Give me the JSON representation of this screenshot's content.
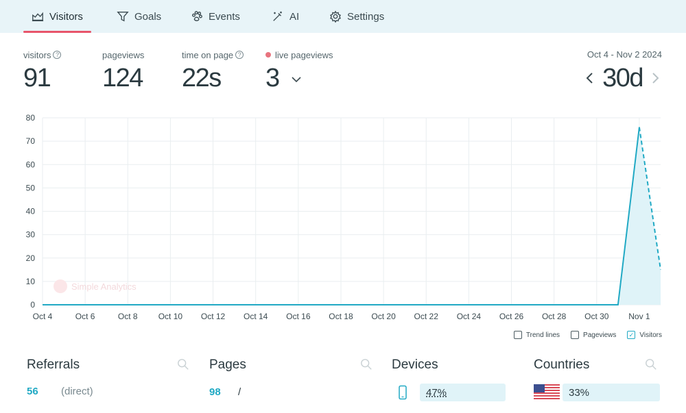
{
  "tabs": [
    {
      "label": "Visitors",
      "icon": "visitors-icon",
      "active": true
    },
    {
      "label": "Goals",
      "icon": "funnel-icon",
      "active": false
    },
    {
      "label": "Events",
      "icon": "paw-icon",
      "active": false
    },
    {
      "label": "AI",
      "icon": "magic-wand-icon",
      "active": false
    },
    {
      "label": "Settings",
      "icon": "gear-icon",
      "active": false
    }
  ],
  "metrics": {
    "visitors": {
      "label": "visitors",
      "value": "91"
    },
    "pageviews": {
      "label": "pageviews",
      "value": "124"
    },
    "time_on_page": {
      "label": "time on page",
      "value": "22s"
    },
    "live": {
      "label": "live pageviews",
      "value": "3"
    }
  },
  "range": {
    "label": "Oct 4 - Nov 2 2024",
    "value": "30d"
  },
  "chart_data": {
    "type": "area",
    "x": [
      "Oct 4",
      "Oct 5",
      "Oct 6",
      "Oct 7",
      "Oct 8",
      "Oct 9",
      "Oct 10",
      "Oct 11",
      "Oct 12",
      "Oct 13",
      "Oct 14",
      "Oct 15",
      "Oct 16",
      "Oct 17",
      "Oct 18",
      "Oct 19",
      "Oct 20",
      "Oct 21",
      "Oct 22",
      "Oct 23",
      "Oct 24",
      "Oct 25",
      "Oct 26",
      "Oct 27",
      "Oct 28",
      "Oct 29",
      "Oct 30",
      "Oct 31",
      "Nov 1",
      "Nov 2"
    ],
    "x_tick_labels": [
      "Oct 4",
      "Oct 6",
      "Oct 8",
      "Oct 10",
      "Oct 12",
      "Oct 14",
      "Oct 16",
      "Oct 18",
      "Oct 20",
      "Oct 22",
      "Oct 24",
      "Oct 26",
      "Oct 28",
      "Oct 30",
      "Nov 1"
    ],
    "series": [
      {
        "name": "Visitors",
        "values": [
          0,
          0,
          0,
          0,
          0,
          0,
          0,
          0,
          0,
          0,
          0,
          0,
          0,
          0,
          0,
          0,
          0,
          0,
          0,
          0,
          0,
          0,
          0,
          0,
          0,
          0,
          0,
          0,
          76,
          15
        ],
        "color": "#20a9c4",
        "dashed_last_segment": true
      }
    ],
    "ylim": [
      0,
      80
    ],
    "y_ticks": [
      0,
      10,
      20,
      30,
      40,
      50,
      60,
      70,
      80
    ],
    "grid": true,
    "watermark": "Simple Analytics"
  },
  "legend": [
    {
      "label": "Trend lines",
      "checked": false
    },
    {
      "label": "Pageviews",
      "checked": false
    },
    {
      "label": "Visitors",
      "checked": true
    }
  ],
  "referrals": {
    "title": "Referrals",
    "rows": [
      {
        "count": "56",
        "label": "(direct)"
      }
    ]
  },
  "pages": {
    "title": "Pages",
    "rows": [
      {
        "count": "98",
        "label": "/"
      }
    ]
  },
  "devices": {
    "title": "Devices",
    "rows": [
      {
        "percent": "47%",
        "share": 0.47,
        "icon": "phone-icon"
      }
    ]
  },
  "countries": {
    "title": "Countries",
    "rows": [
      {
        "percent": "33%",
        "share": 0.33,
        "icon": "us-flag-icon"
      }
    ]
  },
  "colors": {
    "accent": "#20a9c4",
    "active_tab": "#e8546a",
    "tabbar_bg": "#e8f4f8",
    "bar_bg": "#e0f3f8",
    "live_dot": "#e8747f"
  }
}
